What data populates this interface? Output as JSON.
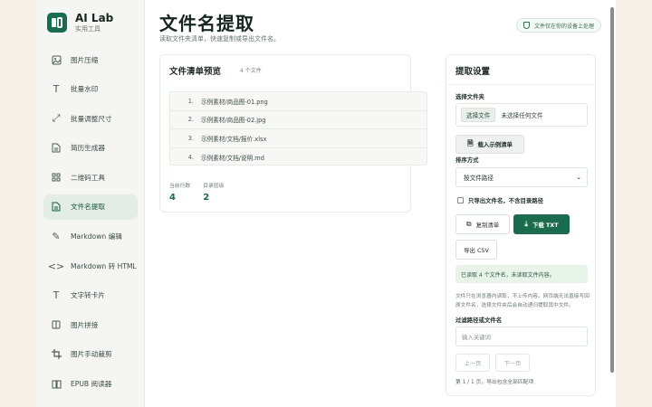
{
  "app": {
    "name": "AI Lab",
    "subtitle": "实用工具"
  },
  "sidebar": {
    "items": [
      {
        "label": "图片压缩",
        "icon": "image-icon"
      },
      {
        "label": "批量水印",
        "icon": "text-icon"
      },
      {
        "label": "批量调整尺寸",
        "icon": "resize-icon"
      },
      {
        "label": "简历生成器",
        "icon": "document-icon"
      },
      {
        "label": "二维码工具",
        "icon": "qrcode-icon"
      },
      {
        "label": "文件名提取",
        "icon": "file-icon",
        "active": true
      },
      {
        "label": "Markdown 编辑",
        "icon": "pen-icon"
      },
      {
        "label": "Markdown 转 HTML",
        "icon": "code-icon"
      },
      {
        "label": "文字转卡片",
        "icon": "text-icon"
      },
      {
        "label": "图片拼接",
        "icon": "grid-icon"
      },
      {
        "label": "图片手动裁剪",
        "icon": "crop-icon"
      },
      {
        "label": "EPUB 阅读器",
        "icon": "book-icon"
      }
    ]
  },
  "page": {
    "title": "文件名提取",
    "description": "读取文件夹清单，快速复制或导出文件名。",
    "privacy_badge": "文件仅在你的设备上处理"
  },
  "preview": {
    "title": "文件清单预览",
    "count": "4 个文件",
    "files": [
      {
        "index": "1.",
        "path": "示例素材/商品图-01.png"
      },
      {
        "index": "2.",
        "path": "示例素材/商品图-02.jpg"
      },
      {
        "index": "3.",
        "path": "示例素材/文档/报价.xlsx"
      },
      {
        "index": "4.",
        "path": "示例素材/文档/说明.md"
      }
    ],
    "stats": [
      {
        "label": "当前行数",
        "value": "4"
      },
      {
        "label": "目录层级",
        "value": "2"
      }
    ]
  },
  "settings": {
    "title": "提取设置",
    "folder_label": "选择文件夹",
    "choose_button": "选择文件",
    "no_folder": "未选择任何文件",
    "load_sample": "载入示例清单",
    "sort_label": "排序方式",
    "sort_value": "按文件路径",
    "filename_only": "只导出文件名，不含目录路径",
    "copy_button": "复制清单",
    "download_button": "下载 TXT",
    "export_csv": "导出 CSV",
    "status": "已读取 4 个文件名，未读取文件内容。",
    "note": "文件只在浏览器内读取，不上传内容。网页端无法直接写回原文件名，选择文件夹后会自动递归提取其中文件。",
    "filter_label": "过滤路径或文件名",
    "filter_placeholder": "输入关键词",
    "prev": "上一页",
    "next": "下一页",
    "pager_info": "第 1 / 1 页，导出包含全部匹配项"
  },
  "colors": {
    "accent": "#1b6b4f",
    "background": "#f6f1e6"
  }
}
